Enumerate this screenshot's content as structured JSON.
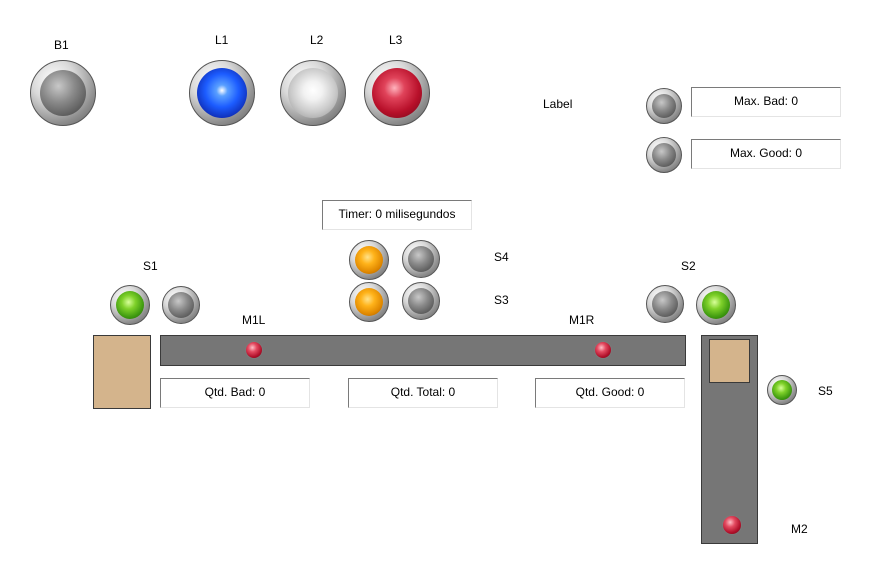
{
  "labels": {
    "b1": "B1",
    "l1": "L1",
    "l2": "L2",
    "l3": "L3",
    "label": "Label",
    "s1": "S1",
    "s2": "S2",
    "s3": "S3",
    "s4": "S4",
    "s5": "S5",
    "m1l": "M1L",
    "m1r": "M1R",
    "m2": "M2"
  },
  "fields": {
    "max_bad": "Max. Bad: 0",
    "max_good": "Max. Good: 0",
    "timer": "Timer: 0 milisegundos",
    "qtd_bad": "Qtd. Bad: 0",
    "qtd_total": "Qtd. Total: 0",
    "qtd_good": "Qtd. Good: 0"
  },
  "colors": {
    "belt": "#767676",
    "box": "#d4b48c",
    "lamp_l1": "blue",
    "lamp_l2": "white",
    "lamp_l3": "red",
    "sensor_s1": "green",
    "sensor_s2": "green",
    "sensor_s5": "green",
    "sensor_s3_left": "orange",
    "sensor_s4_left": "orange",
    "motor_indicator": "red"
  }
}
